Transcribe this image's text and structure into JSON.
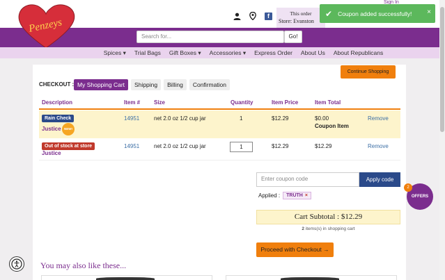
{
  "header": {
    "logo_text": "Penzeys",
    "store_label": "This order",
    "store_name": "Store: Evanston",
    "signin": "Sign In",
    "search_placeholder": "Search for...",
    "go_label": "Go!"
  },
  "toast": {
    "message": "Coupon added successfully!",
    "close": "×"
  },
  "nav": [
    "Spices ▾",
    "Trial Bags",
    "Gift Boxes ▾",
    "Accessories ▾",
    "Express Order",
    "About Us",
    "About Republicans"
  ],
  "checkout": {
    "label": "CHECKOUT :",
    "steps": [
      "My Shopping Cart",
      "Shipping",
      "Billing",
      "Confirmation"
    ],
    "continue_label": "Continue Shopping"
  },
  "table": {
    "headers": [
      "Description",
      "Item #",
      "Size",
      "Quantity",
      "Item Price",
      "Item Total"
    ],
    "rows": [
      {
        "badge": "Rain Check",
        "name": "Justice",
        "sticker": "NEW!",
        "item_no": "14951",
        "size": "net 2.0 oz 1/2 cup jar",
        "quantity": "1",
        "price": "$12.29",
        "total": "$0.00",
        "note": "Coupon Item",
        "remove": "Remove"
      },
      {
        "badge": "Out of stock at store",
        "name": "Justice",
        "item_no": "14951",
        "size": "net 2.0 oz 1/2 cup jar",
        "quantity": "1",
        "price": "$12.29",
        "total": "$12.29",
        "remove": "Remove"
      }
    ]
  },
  "coupon": {
    "placeholder": "Enter coupon code",
    "apply_label": "Apply code",
    "applied_label": "Applied :",
    "applied_code": "TRUTH",
    "remove_x": "×"
  },
  "offers": {
    "label": "OFFERS",
    "count": "2"
  },
  "summary": {
    "subtotal": "Cart Subtotal : $12.29",
    "items_count": "2",
    "items_text": " items(s) in shopping cart",
    "checkout_label": "Proceed with Checkout →"
  },
  "also_like": "You may also like these...",
  "colors": {
    "brand_purple": "#7b2d8e",
    "accent_orange": "#f07f0d",
    "success_green": "#5cb85c",
    "apply_blue": "#2b4a8a"
  }
}
